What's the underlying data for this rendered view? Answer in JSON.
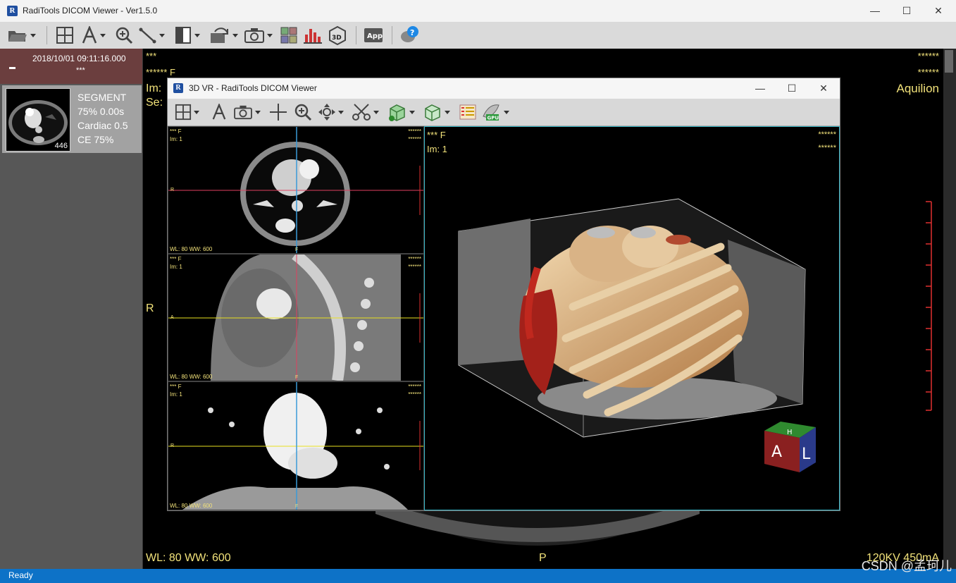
{
  "app": {
    "title": "RadiTools DICOM Viewer - Ver1.5.0",
    "logo_letter": "R",
    "controls": {
      "minimize": "—",
      "maximize": "☐",
      "close": "✕"
    }
  },
  "toolbar": {
    "icons": [
      "open-folder-icon",
      "layout-grid-icon",
      "text-annotation-icon",
      "zoom-icon",
      "measure-icon",
      "window-level-icon",
      "rotate-icon",
      "camera-icon",
      "multi-view-icon",
      "histogram-icon",
      "3d-icon",
      "app-icon",
      "help-icon"
    ]
  },
  "left_panel": {
    "date": "2018/10/01  09:11:16.000",
    "patient": "***",
    "series": {
      "count": "446",
      "lines": [
        "SEGMENT",
        "75%  0.00s",
        "Cardiac  0.5",
        "CE  75%"
      ]
    }
  },
  "viewer": {
    "top_left": "***",
    "top_left_2": "****** F",
    "im": "Im:",
    "se": "Se:",
    "top_right_1": "******",
    "top_right_2": "******",
    "scanner": "Aquilion",
    "side_label": "R",
    "bottom_left": "WL: 80  WW: 600",
    "bottom_center": "P",
    "bottom_right": "120KV  450mA"
  },
  "vr_window": {
    "title": "3D VR - RadiTools DICOM Viewer",
    "logo_letter": "R",
    "controls": {
      "minimize": "—",
      "maximize": "☐",
      "close": "✕"
    },
    "toolbar_icons": [
      "layout-grid-icon",
      "text-annotation-icon",
      "camera-icon",
      "crosshair-icon",
      "zoom-icon",
      "pan-icon",
      "scissors-icon",
      "volume-box-icon",
      "clip-box-icon",
      "color-table-icon",
      "gpu-icon"
    ],
    "gpu_label": "GPU",
    "panes": [
      {
        "tl1": "*** F",
        "tl2": "Im: 1",
        "tr1": "******",
        "tr2": "******",
        "wl": "WL: 80  WW: 600",
        "r": "R",
        "f": "F"
      },
      {
        "tl1": "*** F",
        "tl2": "Im: 1",
        "tr1": "******",
        "tr2": "******",
        "wl": "WL: 80  WW: 600",
        "r": "A",
        "f": "F"
      },
      {
        "tl1": "*** F",
        "tl2": "Im: 1",
        "tr1": "******",
        "tr2": "******",
        "wl": "WL: 80  WW: 600",
        "r": "R",
        "f": "F"
      }
    ],
    "render": {
      "tl1": "*** F",
      "tl2": "Im: 1",
      "tr1": "******",
      "tr2": "******"
    },
    "orientation_cube": {
      "front": "A",
      "side": "L",
      "top": "H"
    }
  },
  "status": {
    "text": "Ready",
    "watermark": "CSDN @孟珂儿"
  },
  "colors": {
    "overlay": "#f2e27a",
    "status_bar": "#0d72c7",
    "header_band": "#6b3e3e",
    "render_border": "#38b4c4"
  }
}
